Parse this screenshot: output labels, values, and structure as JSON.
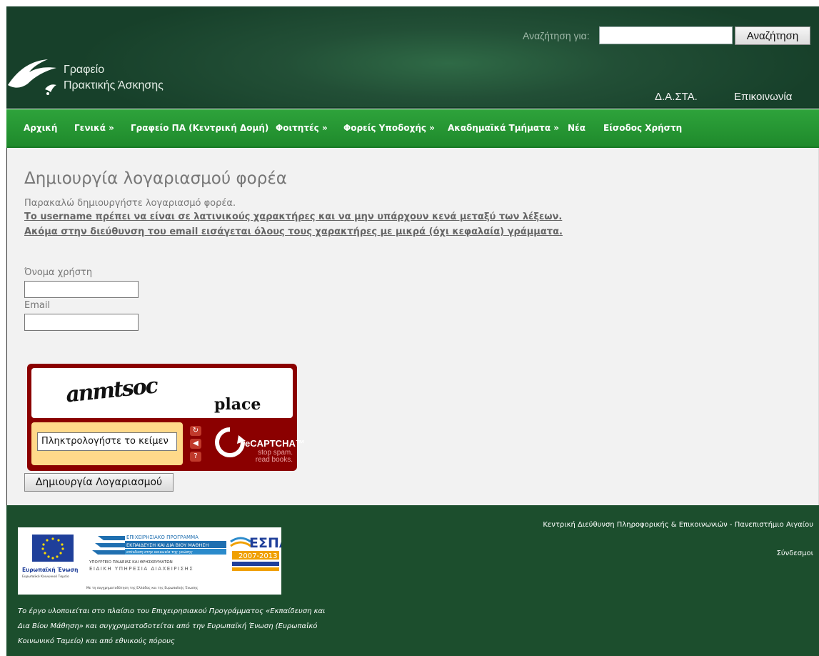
{
  "header": {
    "search_label": "Αναζήτηση για:",
    "search_value": "",
    "search_button": "Αναζήτηση",
    "logo_line1": "Γραφείο",
    "logo_line2": "Πρακτικής Άσκησης",
    "top_links": [
      "Δ.Α.ΣΤΑ.",
      "Επικοινωνία"
    ]
  },
  "nav": {
    "items": [
      "Αρχική",
      "Γενικά »",
      "Γραφείο ΠΑ (Κεντρική Δομή)",
      "Φοιτητές »",
      "Φορείς Υποδοχής »",
      "Ακαδημαϊκά Τμήματα »",
      "Νέα",
      "Είσοδος Χρήστη"
    ]
  },
  "main": {
    "title": "Δημιουργία λογαριασμού φορέα",
    "intro": "Παρακαλώ δημιουργήστε λογαριασμό φορέα.",
    "rules": [
      "Το username πρέπει να είναι σε λατινικούς χαρακτήρες και να μην υπάρχουν κενά μεταξύ των λέξεων.",
      "Ακόμα στην διεύθυνση του email εισάγεται όλους τους χαρακτήρες με μικρά (όχι κεφαλαία) γράμματα."
    ],
    "username_label": "Όνομα χρήστη",
    "email_label": "Email",
    "username_value": "",
    "email_value": "",
    "captcha": {
      "word1": "anmtsoc",
      "word2": "place",
      "input_placeholder": "Πληκτρολογήστε το κείμεν",
      "brand": "reCAPTCHA™",
      "tagline_1": "stop spam.",
      "tagline_2": "read books."
    },
    "submit_label": "Δημιουργία Λογαριασμού"
  },
  "footer": {
    "credit": "Κεντρική Διεύθυνση Πληροφορικής & Επικοινωνιών - Πανεπιστήμιο Αιγαίου",
    "links_label": "Σύνδεσμοι",
    "note": "Το έργο υλοποιείται στο πλαίσιο του Επιχειρησιακού Προγράμματος «Εκπαίδευση και Δια Βίου Μάθηση» και συγχρηματοδοτείται από την Ευρωπαϊκή Ένωση (Ευρωπαϊκό Κοινωνικό Ταμείο) και από εθνικούς πόρους",
    "banner": {
      "eu": "Ευρωπαϊκή Ένωση",
      "eu_sub": "Ευρωπαϊκό Κοινωνικό Ταμείο",
      "program_1": "ΕΠΙΧΕΙΡΗΣΙΑΚΟ ΠΡΟΓΡΑΜΜΑ",
      "program_2": "ΕΚΠΑΙΔΕΥΣΗ ΚΑΙ ΔΙΑ ΒΙΟΥ ΜΑΘΗΣΗ",
      "program_3": "επένδυση στην κοινωνία της γνώσης",
      "ministry_1": "ΥΠΟΥΡΓΕΙΟ ΠΑΙΔΕΙΑΣ ΚΑΙ ΘΡΗΣΚΕΥΜΑΤΩΝ",
      "ministry_2": "ΕΙΔΙΚΗ ΥΠΗΡΕΣΙΑ ΔΙΑΧΕΙΡΙΣΗΣ",
      "cofunding": "Με τη συγχρηματοδότηση της Ελλάδας και της Ευρωπαϊκής Ένωσης",
      "espa": "ΕΣΠΑ",
      "espa_years": "2007-2013"
    }
  },
  "colors": {
    "header_dark": "#17402a",
    "nav_green": "#2ea33b",
    "footer_green": "#1c4e2d",
    "captcha_red": "#8b0000"
  }
}
